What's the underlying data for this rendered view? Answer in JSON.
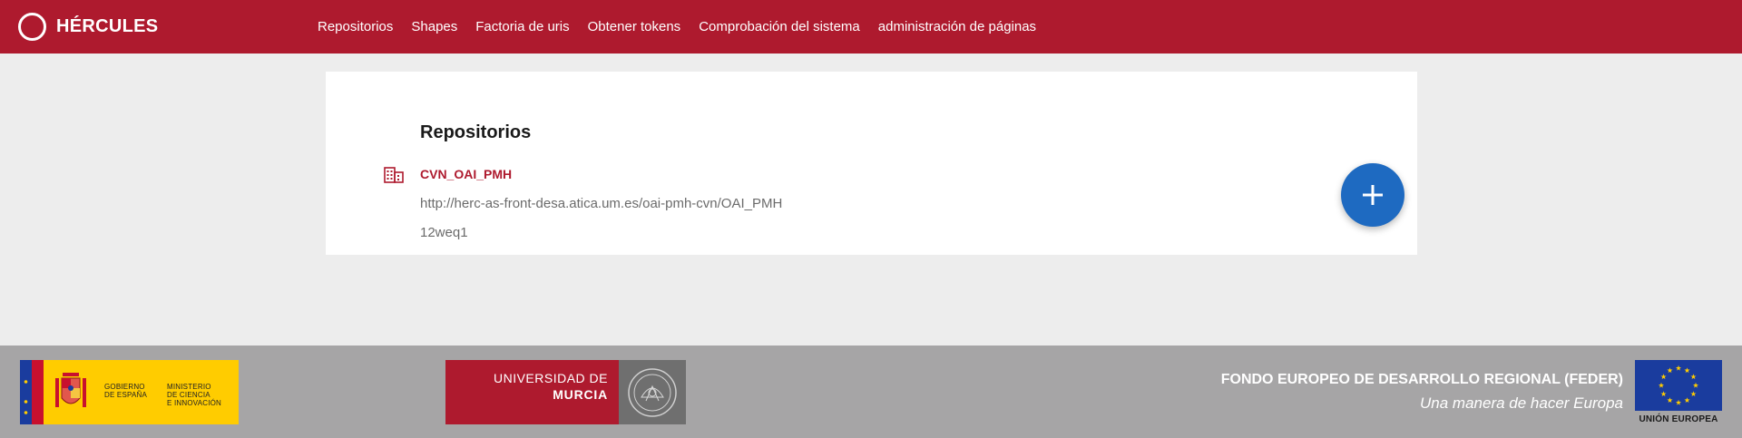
{
  "header": {
    "brand": "HÉRCULES",
    "nav": [
      "Repositorios",
      "Shapes",
      "Factoria de uris",
      "Obtener tokens",
      "Comprobación del sistema",
      "administración de páginas"
    ]
  },
  "main": {
    "title": "Repositorios",
    "repository": {
      "name": "CVN_OAI_PMH",
      "url": "http://herc-as-front-desa.atica.um.es/oai-pmh-cvn/OAI_PMH",
      "extra": "12weq1"
    },
    "add_button_icon": "plus-icon"
  },
  "footer": {
    "gobierno": {
      "line1": "GOBIERNO",
      "line2": "DE ESPAÑA",
      "ministry1": "MINISTERIO",
      "ministry2": "DE CIENCIA",
      "ministry3": "E INNOVACIÓN"
    },
    "universidad": {
      "line1": "UNIVERSIDAD DE",
      "line2": "MURCIA"
    },
    "feder": {
      "title": "FONDO EUROPEO DE DESARROLLO REGIONAL (FEDER)",
      "subtitle": "Una manera de hacer Europa"
    },
    "eu": {
      "label": "UNIÓN EUROPEA"
    }
  },
  "colors": {
    "brand_red": "#ae1a2e",
    "accent_blue": "#1e6ac1",
    "footer_grey": "#a6a5a6",
    "eu_blue": "#1a3c9e",
    "gov_yellow": "#ffcc00"
  }
}
